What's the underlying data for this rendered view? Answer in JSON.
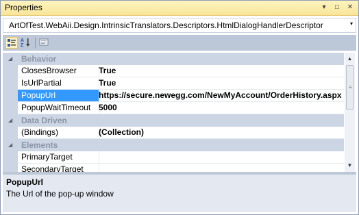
{
  "window": {
    "title": "Properties",
    "controls": {
      "dropdown_glyph": "▾",
      "maximize_glyph": "□",
      "close_glyph": "✕"
    }
  },
  "object_selector": {
    "value": "ArtOfTest.WebAii.Design.IntrinsicTranslators.Descriptors.HtmlDialogHandlerDescriptor",
    "arrow_glyph": "▾"
  },
  "toolbar": {
    "buttons": [
      {
        "icon": "categorized-icon",
        "active": true
      },
      {
        "icon": "alphabetical-icon",
        "active": false
      },
      {
        "icon": "property-pages-icon",
        "active": false
      }
    ]
  },
  "grid": {
    "expander_glyph": "◢",
    "categories": [
      {
        "name": "Behavior",
        "properties": [
          {
            "name": "ClosesBrowser",
            "value": "True"
          },
          {
            "name": "IsUrlPartial",
            "value": "True"
          },
          {
            "name": "PopupUrl",
            "value": "https://secure.newegg.com/NewMyAccount/OrderHistory.aspx",
            "selected": true
          },
          {
            "name": "PopupWaitTimeout",
            "value": "5000"
          }
        ]
      },
      {
        "name": "Data Driven",
        "properties": [
          {
            "name": "(Bindings)",
            "value": "(Collection)"
          }
        ]
      },
      {
        "name": "Elements",
        "properties": [
          {
            "name": "PrimaryTarget",
            "value": ""
          },
          {
            "name": "SecondaryTarget",
            "value": ""
          }
        ]
      }
    ]
  },
  "scrollbar": {
    "up_glyph": "▲",
    "down_glyph": "▼",
    "grip_glyph": "≡"
  },
  "description": {
    "title": "PopupUrl",
    "text": "The Url of the pop-up window"
  },
  "colors": {
    "title_bar": "#f8e59a",
    "selection": "#3399ff",
    "category_band": "#ccd5e4",
    "toolbar_bg": "#bcc7d8",
    "description_bg": "#e3e8f1"
  }
}
